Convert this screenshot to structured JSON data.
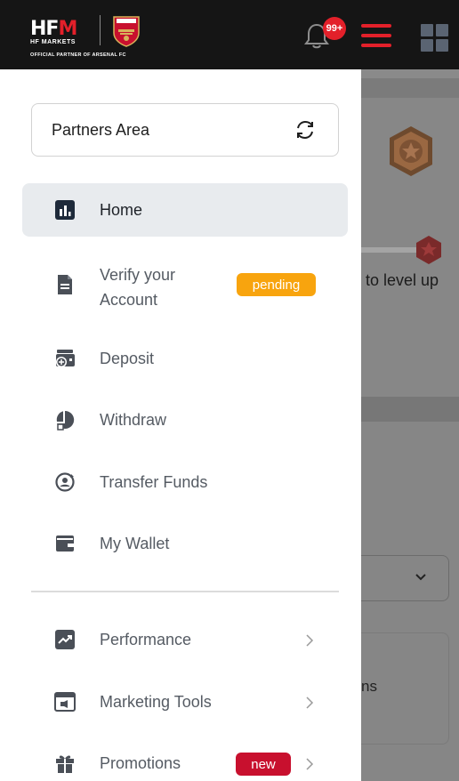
{
  "header": {
    "logo_main": "HF",
    "logo_m": "M",
    "logo_sub": "HF MARKETS",
    "logo_partner": "OFFICIAL PARTNER OF ARSENAL FC",
    "crest_text": "Arsenal",
    "notification_badge": "99+"
  },
  "drawer": {
    "partners_area": "Partners Area",
    "items": [
      {
        "label": "Home",
        "icon": "chart-bars-icon",
        "active": true
      },
      {
        "label": "Verify your\nAccount",
        "icon": "document-icon",
        "badge": "pending"
      },
      {
        "label": "Deposit",
        "icon": "deposit-icon"
      },
      {
        "label": "Withdraw",
        "icon": "withdraw-icon"
      },
      {
        "label": "Transfer Funds",
        "icon": "transfer-icon"
      },
      {
        "label": "My Wallet",
        "icon": "wallet-icon"
      },
      {
        "label": "Performance",
        "icon": "performance-icon",
        "chevron": true
      },
      {
        "label": "Marketing Tools",
        "icon": "marketing-icon",
        "chevron": true
      },
      {
        "label": "Promotions",
        "icon": "gift-icon",
        "badge": "new",
        "chevron": true
      }
    ]
  },
  "background": {
    "level_text": "to level up",
    "card_text": "ns"
  },
  "colors": {
    "brand_red": "#e3202a",
    "pending": "#f8a40e",
    "new": "#c8102e",
    "active_bg": "#e8ebee"
  }
}
